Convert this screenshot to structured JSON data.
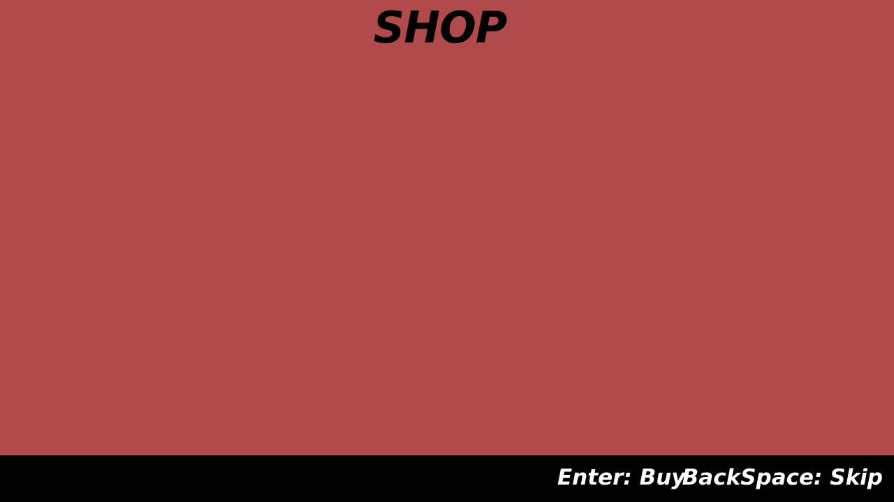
{
  "screen": {
    "title": "SHOP",
    "background_color": "#b04a4b"
  },
  "controls": {
    "buy_hint": "Enter: Buy",
    "skip_hint": "BackSpace: Skip",
    "bar_color": "#000000",
    "text_color": "#ffffff"
  }
}
